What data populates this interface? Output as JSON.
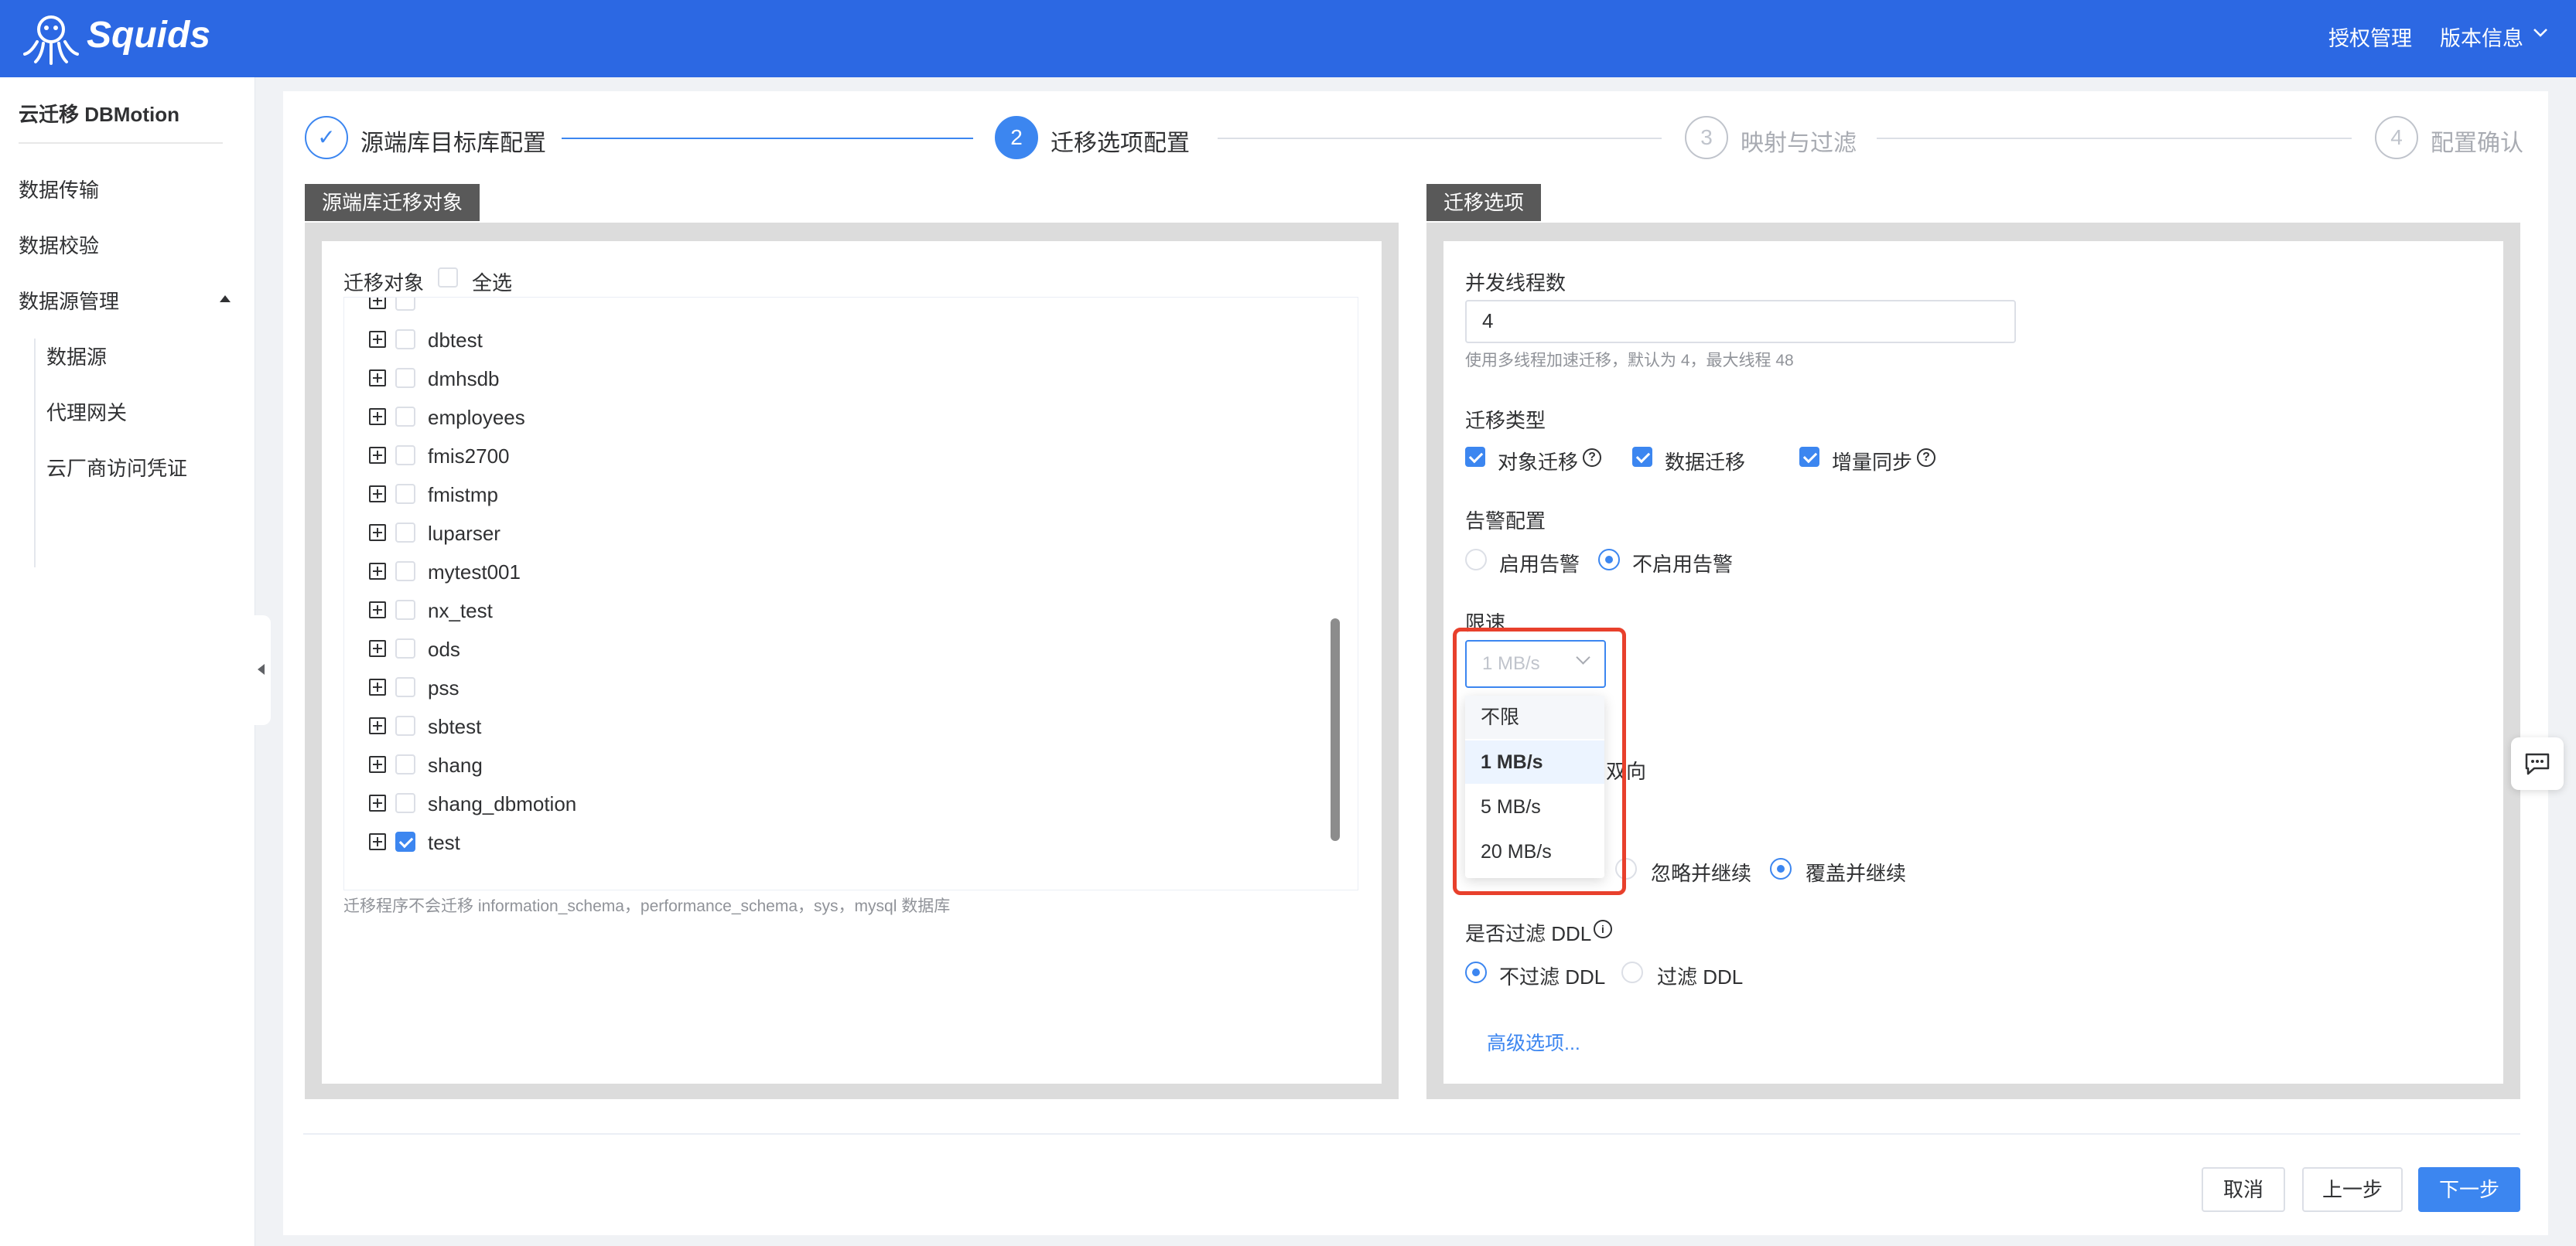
{
  "header": {
    "brand": "Squids",
    "links": [
      "授权管理",
      "版本信息"
    ]
  },
  "sidebar": {
    "title": "云迁移 DBMotion",
    "items": [
      "数据传输",
      "数据校验",
      "数据源管理"
    ],
    "subitems": [
      "数据源",
      "代理网关",
      "云厂商访问凭证"
    ]
  },
  "steps": [
    {
      "num": "✓",
      "label": "源端库目标库配置"
    },
    {
      "num": "2",
      "label": "迁移选项配置"
    },
    {
      "num": "3",
      "label": "映射与过滤"
    },
    {
      "num": "4",
      "label": "配置确认"
    }
  ],
  "left_panel": {
    "tag": "源端库迁移对象",
    "objects_label": "迁移对象",
    "select_all": "全选",
    "databases": [
      {
        "name": "dbtest",
        "checked": false
      },
      {
        "name": "dmhsdb",
        "checked": false
      },
      {
        "name": "employees",
        "checked": false
      },
      {
        "name": "fmis2700",
        "checked": false
      },
      {
        "name": "fmistmp",
        "checked": false
      },
      {
        "name": "luparser",
        "checked": false
      },
      {
        "name": "mytest001",
        "checked": false
      },
      {
        "name": "nx_test",
        "checked": false
      },
      {
        "name": "ods",
        "checked": false
      },
      {
        "name": "pss",
        "checked": false
      },
      {
        "name": "sbtest",
        "checked": false
      },
      {
        "name": "shang",
        "checked": false
      },
      {
        "name": "shang_dbmotion",
        "checked": false
      },
      {
        "name": "test",
        "checked": true
      }
    ],
    "note": "迁移程序不会迁移 information_schema，performance_schema，sys，mysql 数据库"
  },
  "right_panel": {
    "tag": "迁移选项",
    "threads_label": "并发线程数",
    "threads_value": "4",
    "threads_hint": "使用多线程加速迁移，默认为 4，最大线程 48",
    "type_label": "迁移类型",
    "types": [
      {
        "label": "对象迁移",
        "checked": true
      },
      {
        "label": "数据迁移",
        "checked": true
      },
      {
        "label": "增量同步",
        "checked": true
      }
    ],
    "alert_label": "告警配置",
    "alert_options": [
      {
        "label": "启用告警",
        "on": false
      },
      {
        "label": "不启用告警",
        "on": true
      }
    ],
    "limit_label": "限速",
    "limit_value": "1 MB/s",
    "limit_options": [
      "不限",
      "1 MB/s",
      "5 MB/s",
      "20 MB/s"
    ],
    "hidden_fragment": "双向",
    "conflict_options": [
      {
        "label": "忽略并继续",
        "on": false
      },
      {
        "label": "覆盖并继续",
        "on": true
      }
    ],
    "ddl_label": "是否过滤 DDL",
    "ddl_options": [
      {
        "label": "不过滤 DDL",
        "on": true
      },
      {
        "label": "过滤 DDL",
        "on": false
      }
    ],
    "advanced": "高级选项..."
  },
  "footer": {
    "cancel": "取消",
    "prev": "上一步",
    "next": "下一步"
  }
}
